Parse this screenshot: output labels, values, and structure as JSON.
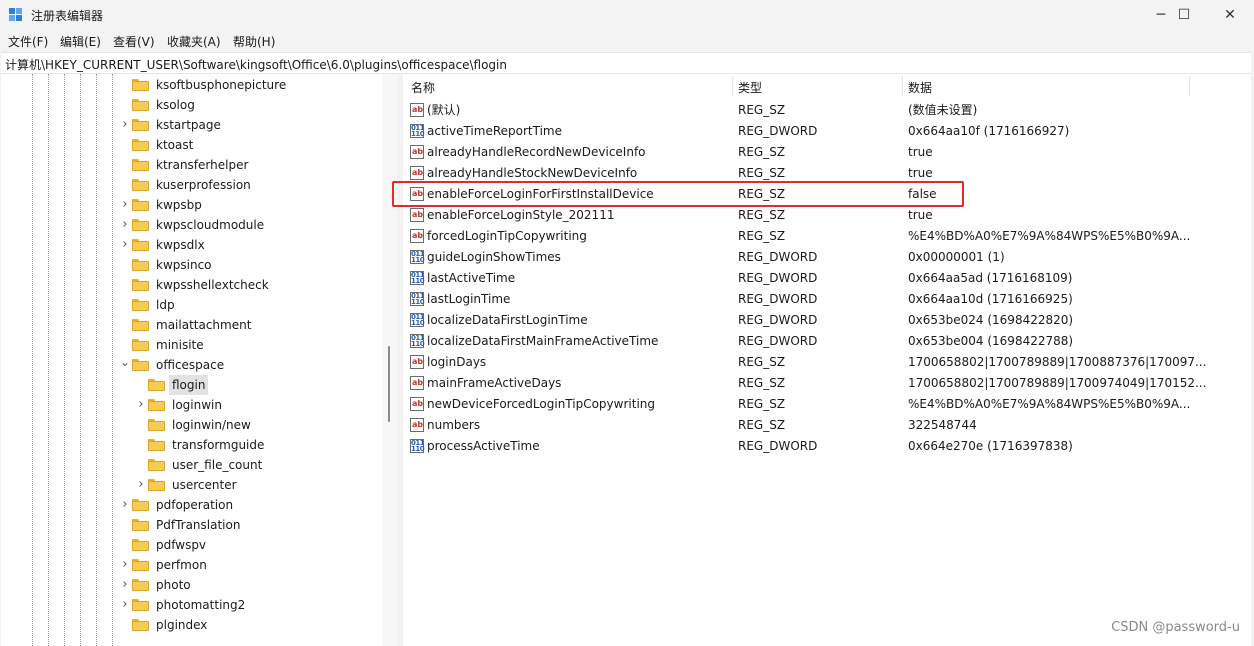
{
  "window": {
    "title": "注册表编辑器",
    "controls": {
      "minimize": "─",
      "maximize": "☐",
      "close": "✕"
    }
  },
  "menu": [
    "文件(F)",
    "编辑(E)",
    "查看(V)",
    "收藏夹(A)",
    "帮助(H)"
  ],
  "address": "计算机\\HKEY_CURRENT_USER\\Software\\kingsoft\\Office\\6.0\\plugins\\officespace\\flogin",
  "tree": {
    "items": [
      {
        "label": "ksoftbusphonepicture",
        "level": 1,
        "expander": "none"
      },
      {
        "label": "ksolog",
        "level": 1,
        "expander": "none"
      },
      {
        "label": "kstartpage",
        "level": 1,
        "expander": "collapsed"
      },
      {
        "label": "ktoast",
        "level": 1,
        "expander": "none"
      },
      {
        "label": "ktransferhelper",
        "level": 1,
        "expander": "none"
      },
      {
        "label": "kuserprofession",
        "level": 1,
        "expander": "none"
      },
      {
        "label": "kwpsbp",
        "level": 1,
        "expander": "collapsed"
      },
      {
        "label": "kwpscloudmodule",
        "level": 1,
        "expander": "collapsed"
      },
      {
        "label": "kwpsdlx",
        "level": 1,
        "expander": "collapsed"
      },
      {
        "label": "kwpsinco",
        "level": 1,
        "expander": "none"
      },
      {
        "label": "kwpsshellextcheck",
        "level": 1,
        "expander": "none"
      },
      {
        "label": "ldp",
        "level": 1,
        "expander": "none"
      },
      {
        "label": "mailattachment",
        "level": 1,
        "expander": "none"
      },
      {
        "label": "minisite",
        "level": 1,
        "expander": "none"
      },
      {
        "label": "officespace",
        "level": 1,
        "expander": "expanded"
      },
      {
        "label": "flogin",
        "level": 2,
        "expander": "none",
        "selected": true
      },
      {
        "label": "loginwin",
        "level": 2,
        "expander": "collapsed"
      },
      {
        "label": "loginwin/new",
        "level": 2,
        "expander": "none"
      },
      {
        "label": "transformguide",
        "level": 2,
        "expander": "none"
      },
      {
        "label": "user_file_count",
        "level": 2,
        "expander": "none"
      },
      {
        "label": "usercenter",
        "level": 2,
        "expander": "collapsed"
      },
      {
        "label": "pdfoperation",
        "level": 1,
        "expander": "collapsed"
      },
      {
        "label": "PdfTranslation",
        "level": 1,
        "expander": "none"
      },
      {
        "label": "pdfwspv",
        "level": 1,
        "expander": "none"
      },
      {
        "label": "perfmon",
        "level": 1,
        "expander": "collapsed"
      },
      {
        "label": "photo",
        "level": 1,
        "expander": "collapsed"
      },
      {
        "label": "photomatting2",
        "level": 1,
        "expander": "collapsed"
      },
      {
        "label": "plgindex",
        "level": 1,
        "expander": "none"
      }
    ]
  },
  "list": {
    "columns": {
      "name": "名称",
      "type": "类型",
      "data": "数据"
    },
    "rows": [
      {
        "name": "(默认)",
        "type": "REG_SZ",
        "data": "(数值未设置)",
        "icon": "string-value-icon"
      },
      {
        "name": "activeTimeReportTime",
        "type": "REG_DWORD",
        "data": "0x664aa10f (1716166927)",
        "icon": "binary-value-icon"
      },
      {
        "name": "alreadyHandleRecordNewDeviceInfo",
        "type": "REG_SZ",
        "data": "true",
        "icon": "string-value-icon"
      },
      {
        "name": "alreadyHandleStockNewDeviceInfo",
        "type": "REG_SZ",
        "data": "true",
        "icon": "string-value-icon"
      },
      {
        "name": "enableForceLoginForFirstInstallDevice",
        "type": "REG_SZ",
        "data": "false",
        "icon": "string-value-icon"
      },
      {
        "name": "enableForceLoginStyle_202111",
        "type": "REG_SZ",
        "data": "true",
        "icon": "string-value-icon"
      },
      {
        "name": "forcedLoginTipCopywriting",
        "type": "REG_SZ",
        "data": "%E4%BD%A0%E7%9A%84WPS%E5%B0%9A...",
        "icon": "string-value-icon"
      },
      {
        "name": "guideLoginShowTimes",
        "type": "REG_DWORD",
        "data": "0x00000001 (1)",
        "icon": "binary-value-icon"
      },
      {
        "name": "lastActiveTime",
        "type": "REG_DWORD",
        "data": "0x664aa5ad (1716168109)",
        "icon": "binary-value-icon"
      },
      {
        "name": "lastLoginTime",
        "type": "REG_DWORD",
        "data": "0x664aa10d (1716166925)",
        "icon": "binary-value-icon"
      },
      {
        "name": "localizeDataFirstLoginTime",
        "type": "REG_DWORD",
        "data": "0x653be024 (1698422820)",
        "icon": "binary-value-icon"
      },
      {
        "name": "localizeDataFirstMainFrameActiveTime",
        "type": "REG_DWORD",
        "data": "0x653be004 (1698422788)",
        "icon": "binary-value-icon"
      },
      {
        "name": "loginDays",
        "type": "REG_SZ",
        "data": "1700658802|1700789889|1700887376|170097...",
        "icon": "string-value-icon"
      },
      {
        "name": "mainFrameActiveDays",
        "type": "REG_SZ",
        "data": "1700658802|1700789889|1700974049|170152...",
        "icon": "string-value-icon"
      },
      {
        "name": "newDeviceForcedLoginTipCopywriting",
        "type": "REG_SZ",
        "data": "%E4%BD%A0%E7%9A%84WPS%E5%B0%9A...",
        "icon": "string-value-icon"
      },
      {
        "name": "numbers",
        "type": "REG_SZ",
        "data": "322548744",
        "icon": "string-value-icon"
      },
      {
        "name": "processActiveTime",
        "type": "REG_DWORD",
        "data": "0x664e270e (1716397838)",
        "icon": "binary-value-icon"
      }
    ]
  },
  "watermark": "CSDN @password-u",
  "colors": {
    "highlight": "#e02b2b",
    "selection": "#e2e2e2",
    "folder": "#f8cc4e"
  }
}
